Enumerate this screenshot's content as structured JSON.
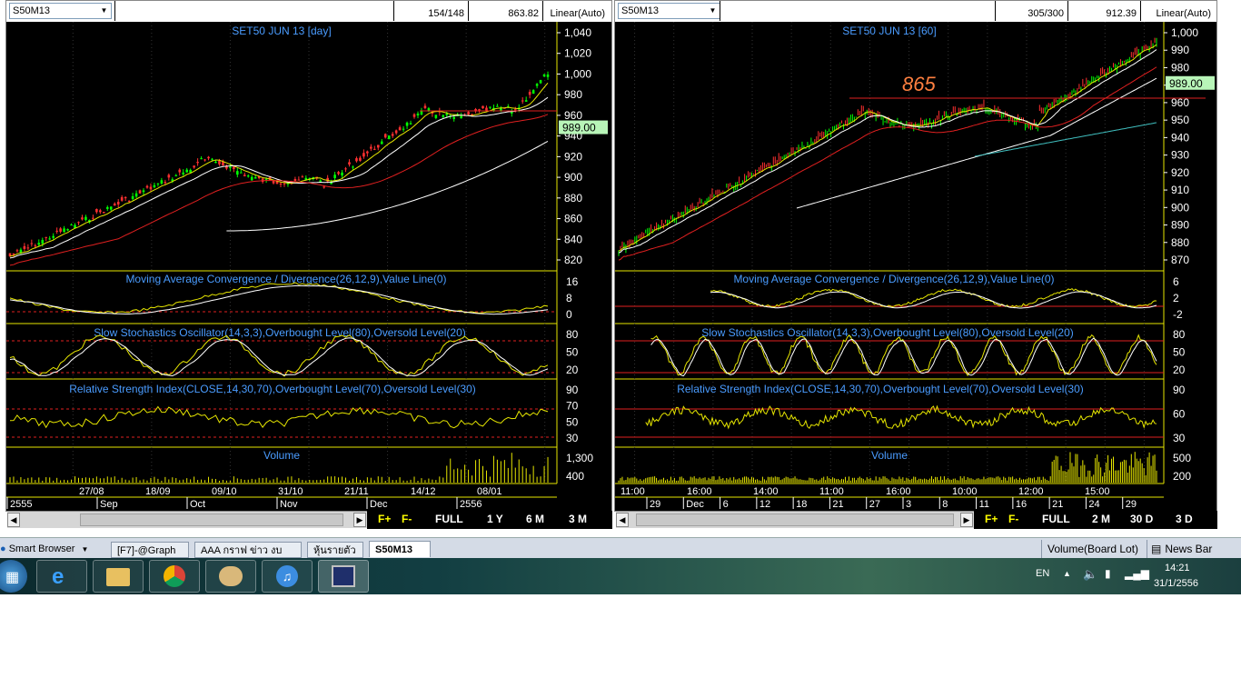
{
  "left_panel": {
    "symbol": "S50M13",
    "bars": "154/148",
    "last_price": "863.82",
    "scale": "Linear(Auto)",
    "title": "SET50 JUN 13",
    "interval": "[day]",
    "current_price": "989.00",
    "price_ticks": [
      "1,040",
      "1,020",
      "1,000",
      "980",
      "960",
      "940",
      "920",
      "900",
      "880",
      "860",
      "840",
      "820"
    ],
    "macd_label": "Moving Average Convergence / Divergence(26,12,9),Value Line(0)",
    "macd_ticks": [
      "16",
      "8",
      "0"
    ],
    "stoch_label": "Slow Stochastics Oscillator(14,3,3),Overbought Level(80),Oversold Level(20)",
    "stoch_ticks": [
      "80",
      "50",
      "20"
    ],
    "rsi_label": "Relative Strength Index(CLOSE,14,30,70),Overbought Level(70),Oversold Level(30)",
    "rsi_ticks": [
      "90",
      "70",
      "50",
      "30"
    ],
    "volume_label": "Volume",
    "volume_ticks": [
      "1,300",
      "400"
    ],
    "date_row1": [
      "27/08",
      "18/09",
      "09/10",
      "31/10",
      "21/11",
      "14/12",
      "08/01"
    ],
    "date_row2": [
      "2555",
      "Sep",
      "Oct",
      "Nov",
      "Dec",
      "2556"
    ],
    "buttons": [
      "FULL",
      "1 Y",
      "6 M",
      "3 M"
    ]
  },
  "right_panel": {
    "symbol": "S50M13",
    "bars": "305/300",
    "last_price": "912.39",
    "scale": "Linear(Auto)",
    "title": "SET50 JUN 13",
    "interval": "[60]",
    "annotation": "865",
    "current_price": "989.00",
    "price_ticks": [
      "1,000",
      "990",
      "980",
      "970",
      "960",
      "950",
      "940",
      "930",
      "920",
      "910",
      "900",
      "890",
      "880",
      "870"
    ],
    "macd_label": "Moving Average Convergence / Divergence(26,12,9),Value Line(0)",
    "macd_ticks": [
      "6",
      "2",
      "-2"
    ],
    "stoch_label": "Slow Stochastics Oscillator(14,3,3),Overbought Level(80),Oversold Level(20)",
    "stoch_ticks": [
      "80",
      "50",
      "20"
    ],
    "rsi_label": "Relative Strength Index(CLOSE,14,30,70),Overbought Level(70),Oversold Level(30)",
    "rsi_ticks": [
      "90",
      "60",
      "30"
    ],
    "volume_label": "Volume",
    "volume_ticks": [
      "500",
      "200"
    ],
    "date_row1": [
      "11:00",
      "16:00",
      "14:00",
      "11:00",
      "16:00",
      "10:00",
      "12:00",
      "15:00"
    ],
    "date_row2": [
      "29",
      "Dec",
      "6",
      "12",
      "18",
      "21",
      "27",
      "3",
      "8",
      "11",
      "16",
      "21",
      "24",
      "29"
    ],
    "buttons": [
      "FULL",
      "2 M",
      "30 D",
      "3 D"
    ]
  },
  "tabs": {
    "browser": "Smart Browser",
    "items": [
      "[F7]-@Graph",
      "AAA กราฟ ข่าว งบ",
      "หุ้นรายตัว",
      "S50M13"
    ],
    "status_volume": "Volume(Board Lot)",
    "status_news": "News Bar"
  },
  "tray": {
    "lang": "EN",
    "time": "14:21",
    "date": "31/1/2556"
  },
  "colors": {
    "accent_blue": "#4a9cff",
    "price_label_bg": "#b8f5b8",
    "yellow_line": "#e6e600",
    "red_line": "#e02020",
    "cyan_line": "#40c0c0",
    "annotation_orange": "#ff8040"
  }
}
